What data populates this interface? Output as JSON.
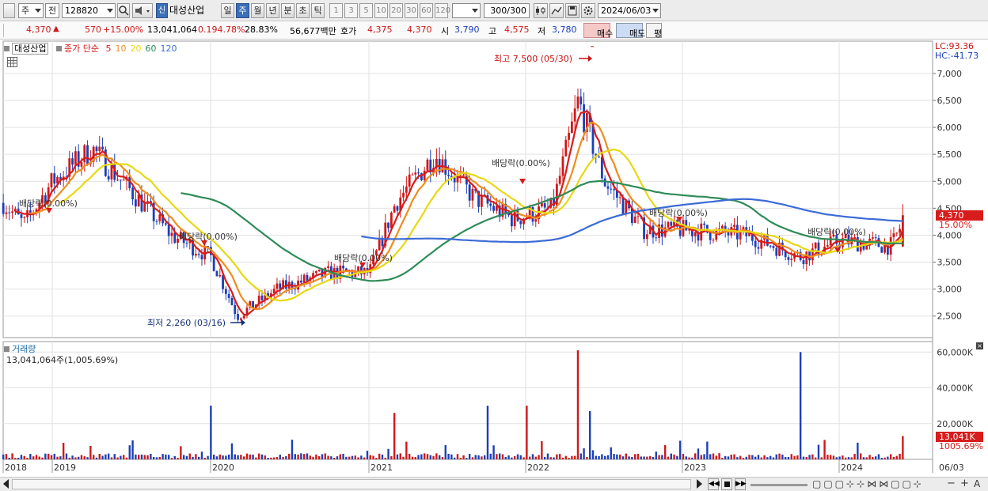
{
  "toolbar": {
    "type_label": "주",
    "prev_label": "전",
    "code": "128820",
    "badge": "신",
    "name": "대성산업",
    "periods": [
      "일",
      "주",
      "월",
      "년",
      "분",
      "초",
      "틱"
    ],
    "selected_period": "주",
    "intervals": [
      "1",
      "3",
      "5",
      "10",
      "20",
      "30",
      "60",
      "120"
    ],
    "count": "300",
    "count_total": "/300",
    "date": "2024/06/03"
  },
  "quote": {
    "price": "4,370",
    "arrow": "▲",
    "change": "570",
    "change_pct": "+15.00%",
    "volume": "13,041,064",
    "volume_ratio": "0.194.78%",
    "turnover_rate": "28.83%",
    "amount": "56,677백만",
    "bid_label": "호가",
    "bid1": "4,375",
    "bid2": "4,370",
    "open_label": "시",
    "open": "3,790",
    "high_label": "고",
    "high": "4,575",
    "low_label": "저",
    "low": "3,780",
    "buy_label": "매수",
    "sell_label": "매도",
    "eval_label": "평"
  },
  "legend": {
    "stock_name": "대성산업",
    "ma_label": "종가 단순",
    "ma_periods": [
      {
        "label": "5",
        "color": "#d81c1c"
      },
      {
        "label": "10",
        "color": "#f08c1e"
      },
      {
        "label": "20",
        "color": "#e8d812"
      },
      {
        "label": "60",
        "color": "#2e8b57"
      },
      {
        "label": "120",
        "color": "#3b6bd6"
      }
    ]
  },
  "price_axis": {
    "ticks": [
      "7,000",
      "6,500",
      "6,000",
      "5,500",
      "5,000",
      "4,500",
      "4,000",
      "3,500",
      "3,000",
      "2,500"
    ],
    "lc_label": "LC:93.36",
    "hc_label": "HC:-41.73",
    "current_price": "4,370",
    "current_pct": "15.00%"
  },
  "annotations": {
    "high_note": "최고 7,500 (05/30)",
    "low_note": "최저 2,260 (03/16)",
    "dividends": [
      "배당락(0.00%)",
      "배당락(0.00%)",
      "배당락(0.00%)",
      "배당락(0.00%)",
      "배당락(0.00%)",
      "배당락(0.00%)"
    ]
  },
  "volume_panel": {
    "title": "거래량",
    "value": "13,041,064주(1,005.69%)",
    "ticks": [
      "60,000K",
      "40,000K",
      "20,000K"
    ],
    "current": "13,041K",
    "current_pct": "1005.69%"
  },
  "x_axis": {
    "labels": [
      "2018",
      "2019",
      "2020",
      "2021",
      "2022",
      "2023",
      "2024"
    ],
    "last_date": "06/03"
  },
  "colors": {
    "up": "#d01818",
    "down": "#1c3fb8",
    "accent": "#3b6fb6"
  },
  "chart_data": {
    "type": "candlestick",
    "title": "",
    "timeframe": "weekly",
    "x_range": [
      "2018",
      "2024-06-03"
    ],
    "ylim": [
      2100,
      7600
    ],
    "price_anchors": [
      {
        "date": "2018-01",
        "close": 4600
      },
      {
        "date": "2018-06",
        "close": 4200
      },
      {
        "date": "2019-01",
        "close": 5000
      },
      {
        "date": "2019-04",
        "close": 5600
      },
      {
        "date": "2019-07",
        "close": 4800
      },
      {
        "date": "2019-10",
        "close": 4000
      },
      {
        "date": "2020-01",
        "close": 3600
      },
      {
        "date": "2020-03",
        "close": 2500
      },
      {
        "date": "2020-06",
        "close": 3000
      },
      {
        "date": "2020-10",
        "close": 3300
      },
      {
        "date": "2021-01",
        "close": 3300
      },
      {
        "date": "2021-03",
        "close": 4600
      },
      {
        "date": "2021-06",
        "close": 5500
      },
      {
        "date": "2021-09",
        "close": 4700
      },
      {
        "date": "2021-12",
        "close": 4300
      },
      {
        "date": "2022-03",
        "close": 4500
      },
      {
        "date": "2022-05",
        "close": 6500
      },
      {
        "date": "2022-07",
        "close": 5000
      },
      {
        "date": "2022-10",
        "close": 4100
      },
      {
        "date": "2023-01",
        "close": 4100
      },
      {
        "date": "2023-06",
        "close": 4000
      },
      {
        "date": "2023-10",
        "close": 3600
      },
      {
        "date": "2024-01",
        "close": 3900
      },
      {
        "date": "2024-05",
        "close": 3800
      },
      {
        "date": "2024-06-03",
        "close": 4370
      }
    ],
    "high": {
      "value": 7500,
      "date": "05/30"
    },
    "low": {
      "value": 2260,
      "date": "03/16"
    },
    "volume_ylim": [
      0,
      65000
    ],
    "volume_unit": "K",
    "volume_spikes": [
      {
        "date": "2020-01",
        "value": 30000
      },
      {
        "date": "2021-03",
        "value": 26000
      },
      {
        "date": "2021-10",
        "value": 30000
      },
      {
        "date": "2022-01",
        "value": 30000
      },
      {
        "date": "2022-05",
        "value": 61000
      },
      {
        "date": "2022-06",
        "value": 27000
      },
      {
        "date": "2023-10",
        "value": 60000
      },
      {
        "date": "2024-06-03",
        "value": 13041
      }
    ]
  }
}
